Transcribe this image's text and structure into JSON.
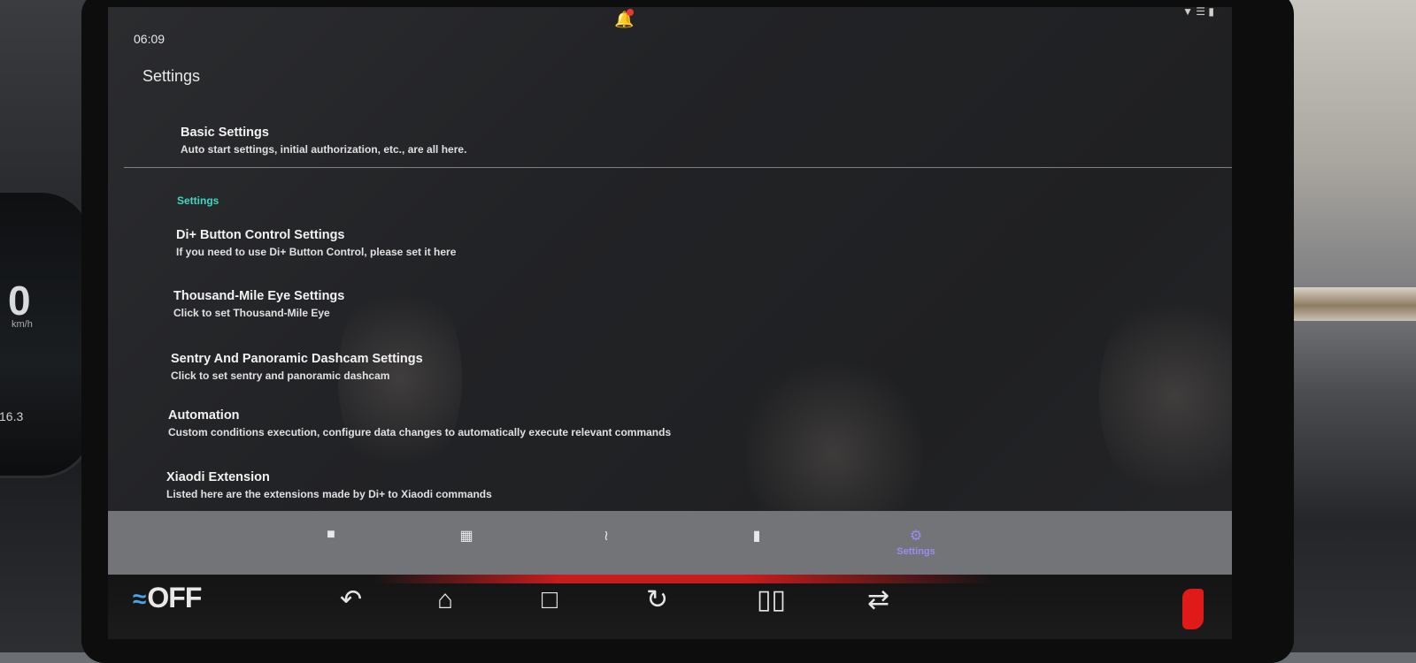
{
  "status_bar": {
    "time": "06:09"
  },
  "header": {
    "title": "Settings"
  },
  "basic": {
    "title": "Basic Settings",
    "subtitle": "Auto start settings, initial authorization, etc., are all here."
  },
  "section": {
    "label": "Settings"
  },
  "items": [
    {
      "title": "Di+ Button Control Settings",
      "subtitle": "If you need to use Di+ Button Control, please set it here"
    },
    {
      "title": "Thousand-Mile Eye Settings",
      "subtitle": "Click to set Thousand-Mile Eye"
    },
    {
      "title": "Sentry And Panoramic Dashcam Settings",
      "subtitle": "Click to set sentry and panoramic dashcam"
    },
    {
      "title": "Automation",
      "subtitle": "Custom conditions execution, configure data changes to automatically execute relevant commands"
    },
    {
      "title": "Xiaodi Extension",
      "subtitle": "Listed here are the extensions made by Di+ to Xiaodi commands"
    }
  ],
  "bottom_nav": {
    "icons": [
      "camera-icon",
      "apps-icon",
      "route-icon",
      "battery-icon",
      "gear-icon"
    ],
    "active_label": "Settings",
    "active_color": "#9b8cf2"
  },
  "system_bar": {
    "ac_status": "OFF",
    "buttons": [
      "back-icon",
      "home-icon",
      "recents-icon",
      "rotate-icon",
      "split-screen-icon",
      "swap-icon"
    ],
    "accent": "#e01919"
  },
  "cluster": {
    "speed": "0",
    "unit": "km/h",
    "odometer": "16.3"
  },
  "colors": {
    "section_accent": "#40d8c4",
    "fan_icon": "#4aa3e6"
  }
}
